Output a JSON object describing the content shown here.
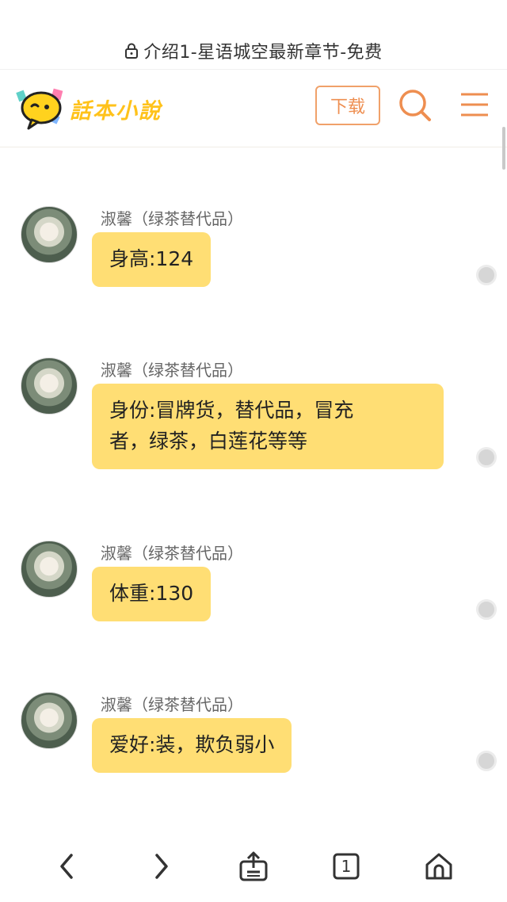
{
  "browser": {
    "url_title": "介绍1-星语城空最新章节-免费",
    "lock_icon": "lock-icon"
  },
  "header": {
    "logo_text": "話本小說",
    "logo_icon": "chat-bubble-logo-icon",
    "download_label": "下载",
    "search_icon": "search-icon",
    "menu_icon": "menu-icon"
  },
  "colors": {
    "accent": "#ee8e50",
    "bubble": "#ffde74",
    "logo": "#ffc21a"
  },
  "messages": [
    {
      "sender": "淑馨（绿茶替代品）",
      "lines": [
        "身高:124"
      ]
    },
    {
      "sender": "淑馨（绿茶替代品）",
      "lines": [
        "身份:冒牌货，替代品，冒充",
        "者，绿茶，白莲花等等"
      ]
    },
    {
      "sender": "淑馨（绿茶替代品）",
      "lines": [
        "体重:130"
      ]
    },
    {
      "sender": "淑馨（绿茶替代品）",
      "lines": [
        "爱好:装，欺负弱小"
      ]
    }
  ],
  "bottom_nav": {
    "tab_count": "1",
    "icons": [
      "back-arrow-icon",
      "forward-arrow-icon",
      "share-icon",
      "tabs-icon",
      "home-icon"
    ]
  }
}
